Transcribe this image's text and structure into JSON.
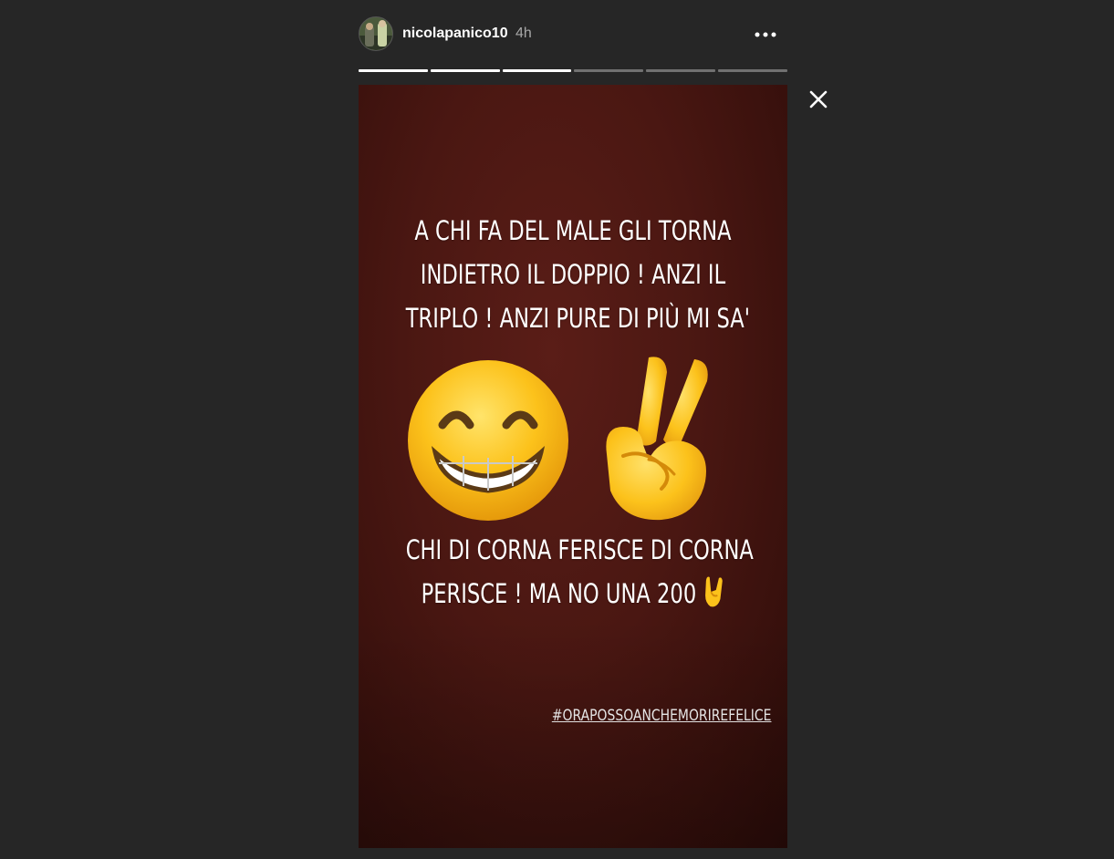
{
  "header": {
    "username": "nicolapanico10",
    "time": "4h",
    "more_icon": "more-dots-icon"
  },
  "progress": {
    "segments": [
      1,
      1,
      1,
      0,
      0,
      0
    ]
  },
  "story": {
    "top_text": [
      "A CHI FA DEL MALE GLI TORNA",
      "INDIETRO  IL DOPPIO ! ANZI IL",
      "TRIPLO ! ANZI PURE DI PIÙ MI SA'"
    ],
    "bottom_text": [
      "CHI DI CORNA FERISCE DI CORNA",
      "PERISCE !  MA NO UNA 200"
    ],
    "hashtag": "#ORAPOSSOANCHEMORIREFELICE",
    "emojis": [
      "grinning-face-icon",
      "victory-hand-icon",
      "sign-of-the-horns-icon"
    ],
    "background_color": "#4a1712"
  },
  "close_icon": "close-icon"
}
